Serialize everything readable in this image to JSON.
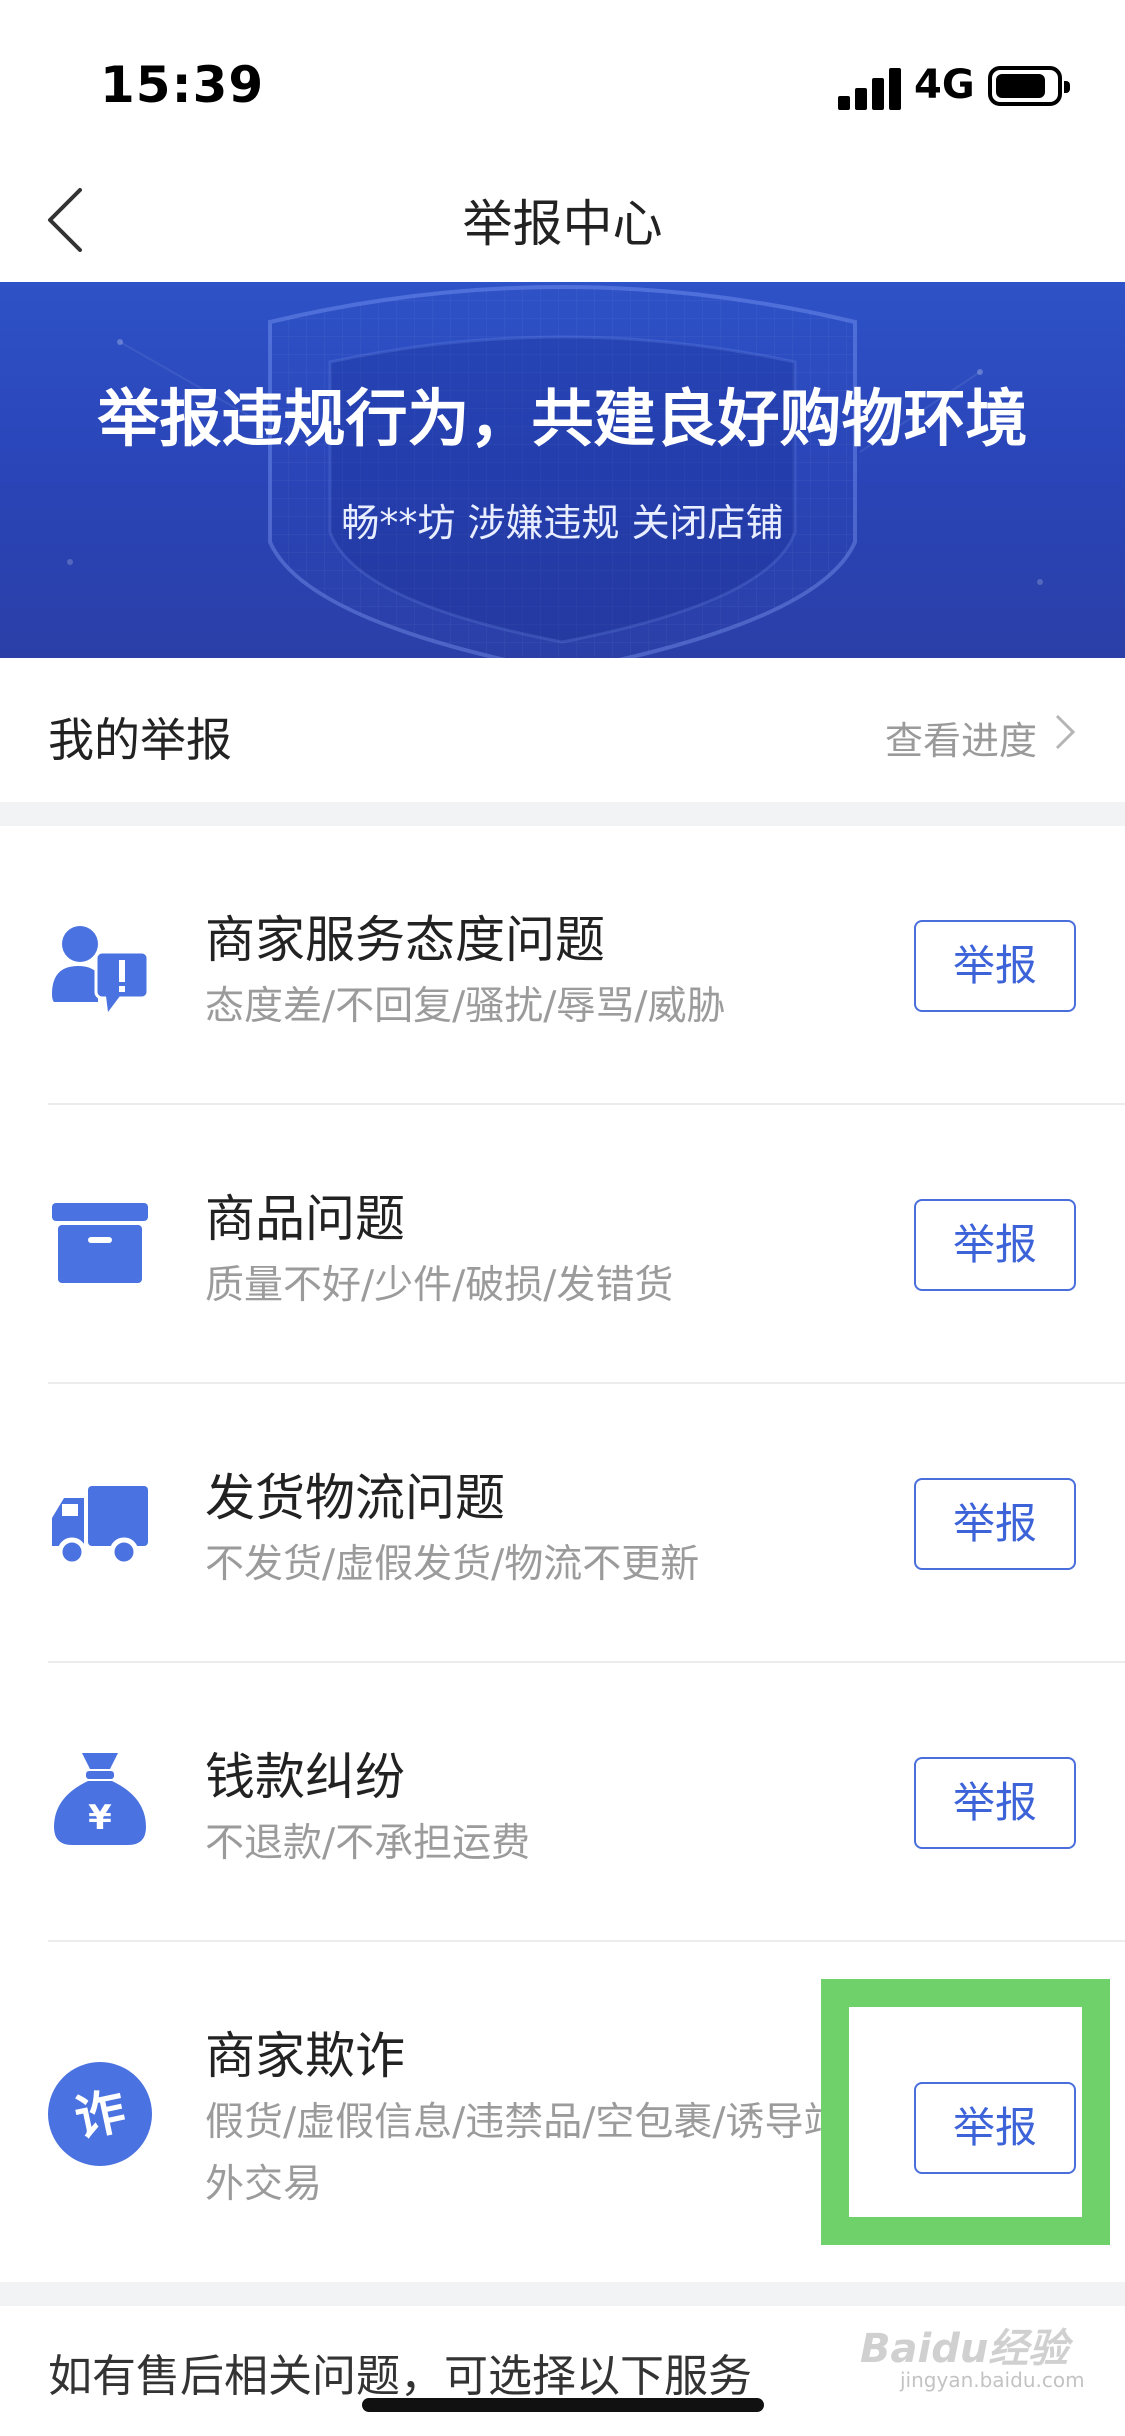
{
  "status_bar": {
    "time": "15:39",
    "network": "4G",
    "battery_level": 0.85
  },
  "nav": {
    "title": "举报中心"
  },
  "banner": {
    "title": "举报违规行为，共建良好购物环境",
    "subtitle": "畅**坊 涉嫌违规 关闭店铺"
  },
  "my_report": {
    "label": "我的举报",
    "link": "查看进度"
  },
  "categories": [
    {
      "title": "商家服务态度问题",
      "desc": "态度差/不回复/骚扰/辱骂/威胁",
      "button": "举报",
      "icon": "customer-service-alert-icon"
    },
    {
      "title": "商品问题",
      "desc": "质量不好/少件/破损/发错货",
      "button": "举报",
      "icon": "package-box-icon"
    },
    {
      "title": "发货物流问题",
      "desc": "不发货/虚假发货/物流不更新",
      "button": "举报",
      "icon": "delivery-truck-icon"
    },
    {
      "title": "钱款纠纷",
      "desc": "不退款/不承担运费",
      "button": "举报",
      "icon": "money-bag-icon"
    },
    {
      "title": "商家欺诈",
      "desc": "假货/虚假信息/违禁品/空包裹/诱导站外交易",
      "button": "举报",
      "icon": "fraud-badge-icon",
      "icon_text": "诈"
    }
  ],
  "footer": {
    "text": "如有售后相关问题，可选择以下服务"
  },
  "watermark": {
    "text": "Baidu经验",
    "sub": "jingyan.baidu.com"
  },
  "colors": {
    "accent": "#3d63d9",
    "icon": "#4a72e0",
    "banner": "#2a45b8",
    "highlight": "#6ed16a"
  }
}
